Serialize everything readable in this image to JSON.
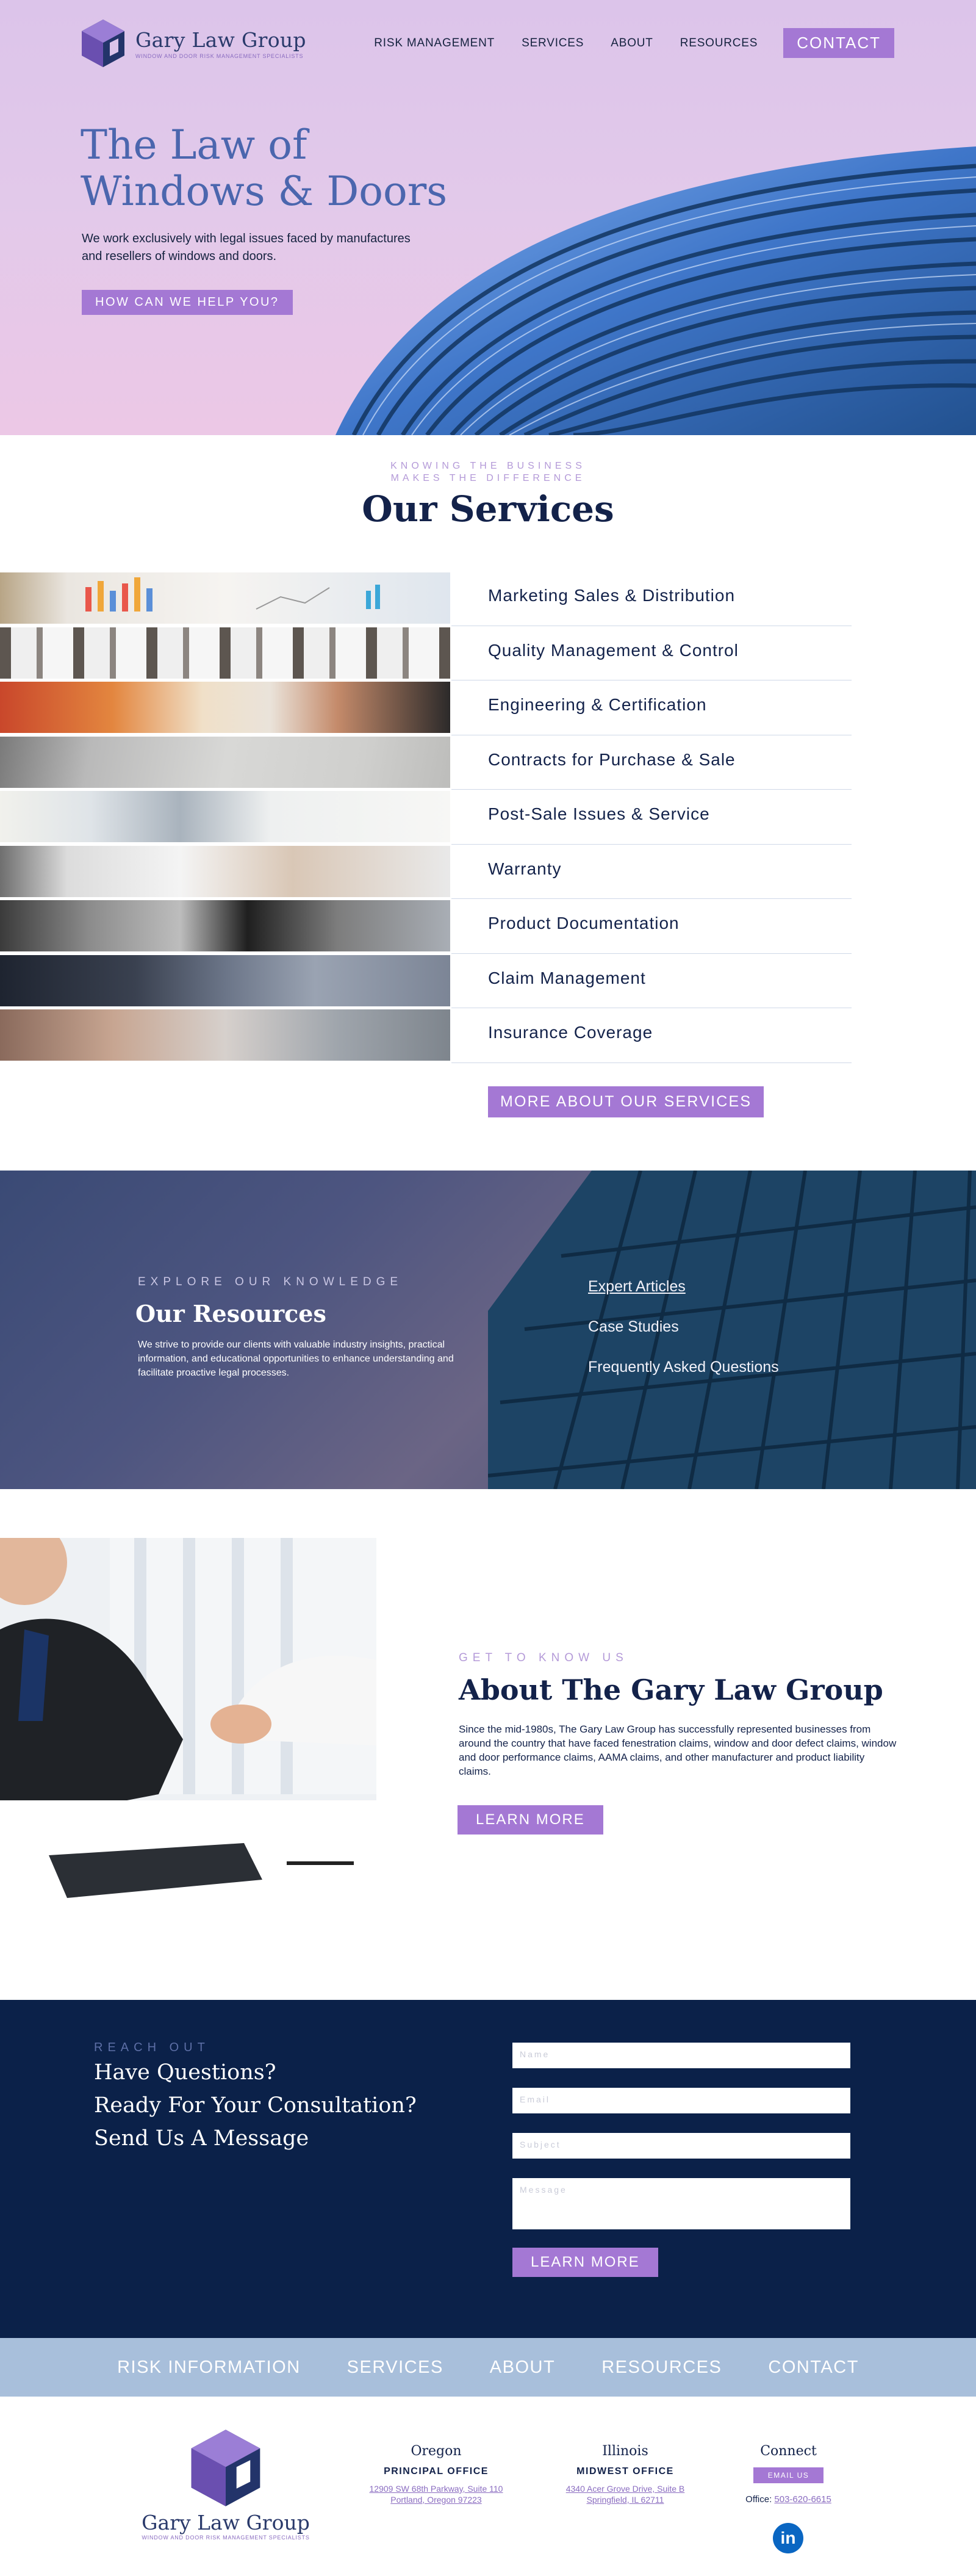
{
  "brand": {
    "name": "Gary Law Group",
    "tagline": "WINDOW AND DOOR RISK MANAGEMENT SPECIALISTS"
  },
  "nav": {
    "items": [
      "RISK MANAGEMENT",
      "SERVICES",
      "ABOUT",
      "RESOURCES"
    ],
    "contact": "CONTACT"
  },
  "hero": {
    "title_line1": "The Law of",
    "title_line2": "Windows & Doors",
    "subtitle": "We work exclusively with legal issues faced by manufactures and resellers of windows and doors.",
    "button": "HOW CAN WE HELP YOU?"
  },
  "services": {
    "kicker_line1": "KNOWING THE BUSINESS",
    "kicker_line2": "MAKES THE DIFFERENCE",
    "title": "Our Services",
    "items": [
      "Marketing Sales & Distribution",
      "Quality Management & Control",
      "Engineering & Certification",
      "Contracts for Purchase & Sale",
      "Post-Sale Issues & Service",
      "Warranty",
      "Product Documentation",
      "Claim Management",
      "Insurance Coverage"
    ],
    "more_button": "MORE ABOUT OUR SERVICES"
  },
  "resources": {
    "kicker": "EXPLORE OUR KNOWLEDGE",
    "title": "Our Resources",
    "text": "We strive to provide our clients with valuable industry insights, practical information, and educational opportunities to enhance understanding and facilitate proactive legal processes.",
    "links": [
      "Expert Articles",
      "Case Studies",
      "Frequently Asked Questions"
    ]
  },
  "about": {
    "kicker": "GET TO KNOW US",
    "title": "About The Gary Law Group",
    "text": "Since the mid-1980s, The Gary Law Group has successfully represented businesses from around the country that have faced fenestration claims, window and door defect claims, window and door performance claims, AAMA claims, and other manufacturer and product liability claims.",
    "button": "LEARN MORE"
  },
  "contact": {
    "kicker": "REACH OUT",
    "line1": "Have Questions?",
    "line2": "Ready For Your Consultation?",
    "line3": "Send Us A Message",
    "fields": {
      "name": "Name",
      "email": "Email",
      "subject": "Subject",
      "message": "Message"
    },
    "button": "LEARN MORE"
  },
  "footer_nav": [
    "RISK INFORMATION",
    "SERVICES",
    "ABOUT",
    "RESOURCES",
    "CONTACT"
  ],
  "footer": {
    "oregon": {
      "state": "Oregon",
      "label": "PRINCIPAL OFFICE",
      "addr1": "12909 SW 68th Parkway, Suite 110",
      "addr2": "Portland, Oregon 97223"
    },
    "illinois": {
      "state": "Illinois",
      "label": "MIDWEST OFFICE",
      "addr1": "4340 Acer Grove Drive, Suite B",
      "addr2": "Springfield, IL 62711"
    },
    "connect": {
      "title": "Connect",
      "email_button": "EMAIL US",
      "office_label": "Office:",
      "office_phone": "503-620-6615"
    },
    "linkedin_glyph": "in"
  },
  "colors": {
    "accent": "#a478d4",
    "navy": "#0b2149",
    "hero_title": "#4b66ae",
    "footer_nav": "#a8bfdb"
  },
  "icons": [
    "logo-cube-icon",
    "linkedin-icon"
  ]
}
